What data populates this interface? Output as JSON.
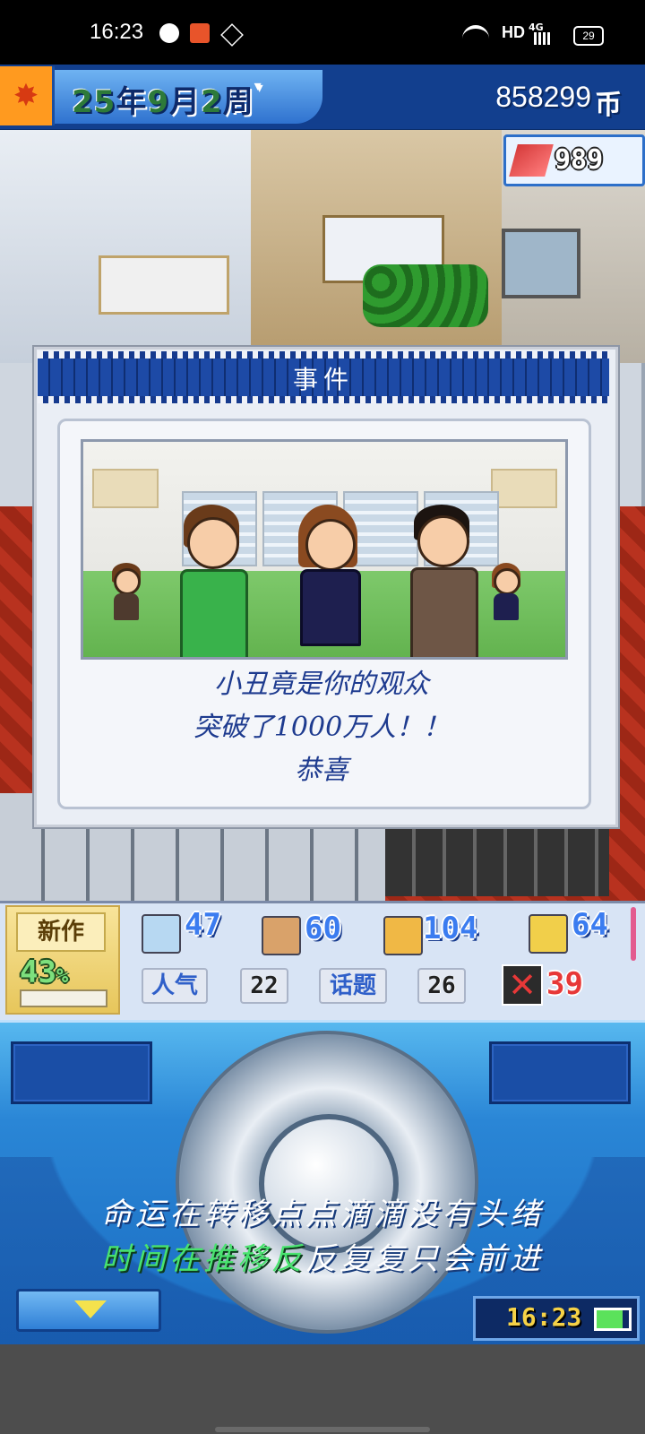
{
  "status_bar": {
    "time": "16:23",
    "network": "HD",
    "signal": "4G",
    "battery": "29"
  },
  "game_bar": {
    "year": "25",
    "year_unit": "年",
    "month": "9",
    "month_unit": "月",
    "week": "2",
    "week_unit": "周",
    "money": "858299",
    "money_unit": "币",
    "points": "989"
  },
  "event": {
    "title": "事件",
    "lines": [
      "小丑竟是你的观众",
      "突破了1000万人！！",
      "恭喜"
    ]
  },
  "stats": {
    "new_work_label": "新作",
    "new_work_pct": "43",
    "new_work_pct_unit": "%",
    "stat1": "47",
    "stat2": "60",
    "stat3": "104",
    "stat4": "64",
    "popularity_label": "人气",
    "popularity": "22",
    "topic_label": "话题",
    "topic": "26",
    "bad": "39"
  },
  "lyrics": {
    "line1": "命运在转移点点滴滴没有头绪",
    "line2_highlight": "时间在推移反",
    "line2_rest": "反复复只会前进"
  },
  "clock": {
    "time": "16:23"
  },
  "colors": {
    "accent_blue": "#123f8e",
    "event_text": "#1e3b8f",
    "bad_red": "#e73838",
    "lyric_green": "#48e36e"
  }
}
